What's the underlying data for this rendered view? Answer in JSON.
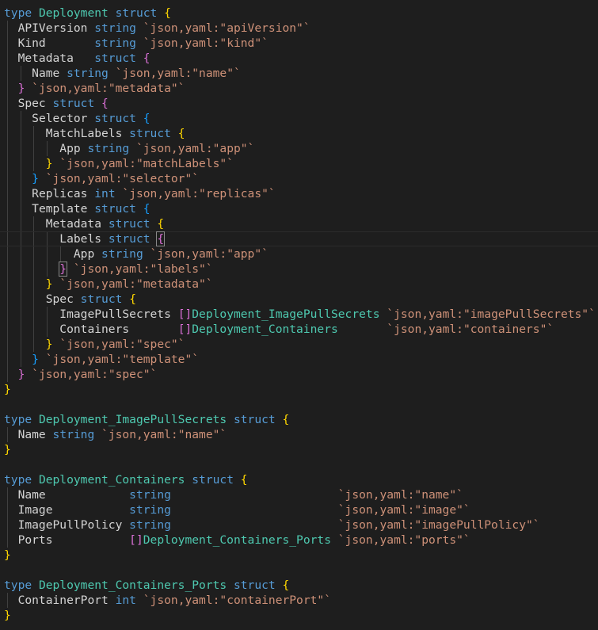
{
  "editor": {
    "language": "go",
    "theme": {
      "background": "#1e1e1e",
      "keyword": "#569cd6",
      "type": "#4ec9b0",
      "string": "#ce9178",
      "text": "#d4d4d4",
      "bracket_levels": [
        "#ffd700",
        "#da70d6",
        "#179fff"
      ]
    },
    "cursor": {
      "line": 16,
      "column": 13
    },
    "lines": [
      "type Deployment struct {",
      "  APIVersion string `json,yaml:\"apiVersion\"`",
      "  Kind       string `json,yaml:\"kind\"`",
      "  Metadata   struct {",
      "    Name string `json,yaml:\"name\"`",
      "  } `json,yaml:\"metadata\"`",
      "  Spec struct {",
      "    Selector struct {",
      "      MatchLabels struct {",
      "        App string `json,yaml:\"app\"`",
      "      } `json,yaml:\"matchLabels\"`",
      "    } `json,yaml:\"selector\"`",
      "    Replicas int `json,yaml:\"replicas\"`",
      "    Template struct {",
      "      Metadata struct {",
      "        Labels struct {",
      "          App string `json,yaml:\"app\"`",
      "        } `json,yaml:\"labels\"`",
      "      } `json,yaml:\"metadata\"`",
      "      Spec struct {",
      "        ImagePullSecrets []Deployment_ImagePullSecrets `json,yaml:\"imagePullSecrets\"`",
      "        Containers       []Deployment_Containers       `json,yaml:\"containers\"`",
      "      } `json,yaml:\"spec\"`",
      "    } `json,yaml:\"template\"`",
      "  } `json,yaml:\"spec\"`",
      "}",
      "",
      "type Deployment_ImagePullSecrets struct {",
      "  Name string `json,yaml:\"name\"`",
      "}",
      "",
      "type Deployment_Containers struct {",
      "  Name            string                        `json,yaml:\"name\"`",
      "  Image           string                        `json,yaml:\"image\"`",
      "  ImagePullPolicy string                        `json,yaml:\"imagePullPolicy\"`",
      "  Ports           []Deployment_Containers_Ports `json,yaml:\"ports\"`",
      "}",
      "",
      "type Deployment_Containers_Ports struct {",
      "  ContainerPort int `json,yaml:\"containerPort\"`",
      "}"
    ]
  }
}
